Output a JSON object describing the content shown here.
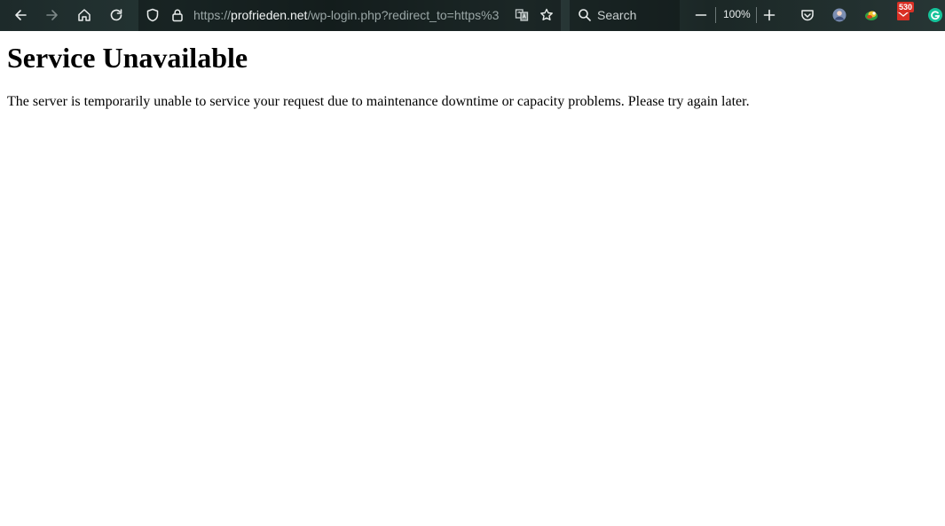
{
  "browser": {
    "url_scheme": "https://",
    "url_host": "profrieden.net",
    "url_path": "/wp-login.php?redirect_to=https%3",
    "search_placeholder": "Search",
    "zoom_level": "100%",
    "mail_badge_count": "530",
    "icons": [
      "back-arrow-icon",
      "forward-arrow-icon",
      "home-icon",
      "reload-icon",
      "shield-icon",
      "lock-icon",
      "translate-icon",
      "star-icon",
      "search-icon",
      "zoom-out-icon",
      "zoom-in-icon",
      "pocket-icon",
      "avatar-extension-icon",
      "color-extension-icon",
      "mail-extension-icon",
      "grammarly-icon"
    ],
    "colors": {
      "badge": "#d93025",
      "grammarly": "#15c39a"
    }
  },
  "page": {
    "heading": "Service Unavailable",
    "message": "The server is temporarily unable to service your request due to maintenance downtime or capacity problems. Please try again later."
  }
}
